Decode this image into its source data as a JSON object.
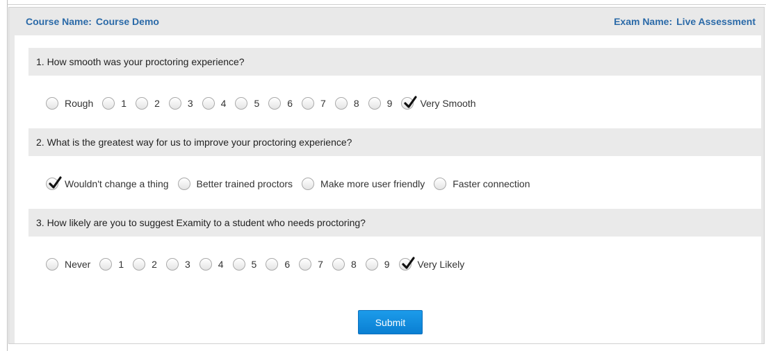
{
  "header": {
    "course_label": "Course Name:",
    "course_value": "Course Demo",
    "exam_label": "Exam Name:",
    "exam_value": "Live Assessment"
  },
  "questions": [
    {
      "text": "1. How smooth was your proctoring experience?",
      "options": [
        "Rough",
        "1",
        "2",
        "3",
        "4",
        "5",
        "6",
        "7",
        "8",
        "9",
        "Very Smooth"
      ],
      "selected": "Very Smooth"
    },
    {
      "text": "2. What is the greatest way for us to improve your proctoring experience?",
      "options": [
        "Wouldn't change a thing",
        "Better trained proctors",
        "Make more user friendly",
        "Faster connection"
      ],
      "selected": "Wouldn't change a thing"
    },
    {
      "text": "3. How likely are you to suggest Examity to a student who needs proctoring?",
      "options": [
        "Never",
        "1",
        "2",
        "3",
        "4",
        "5",
        "6",
        "7",
        "8",
        "9",
        "Very Likely"
      ],
      "selected": "Very Likely"
    }
  ],
  "submit_label": "Submit",
  "colors": {
    "header_text": "#2b6aa8",
    "button": "#0a7fd2",
    "question_bar": "#eaeaea"
  },
  "icons": {
    "radio_unchecked": "radio-icon",
    "radio_checked": "checkmark-icon"
  }
}
